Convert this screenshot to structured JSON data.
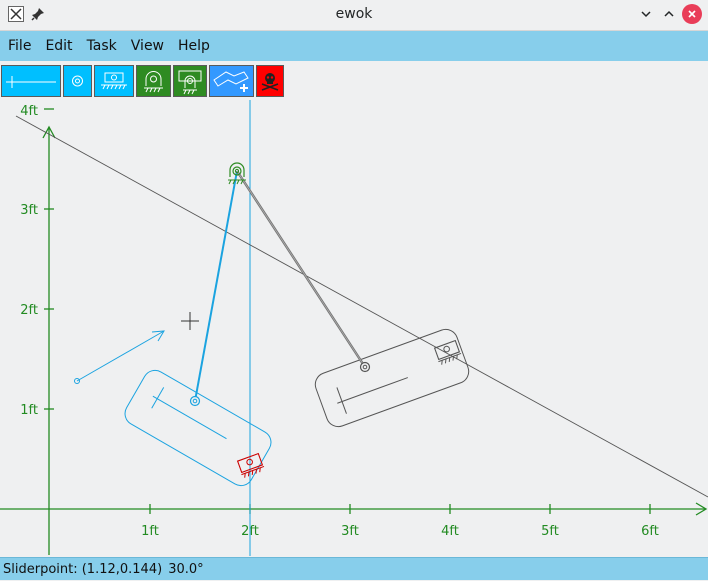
{
  "window": {
    "title": "ewok",
    "app_icon": "ewok-app-icon",
    "pin_icon": "pin-icon",
    "minimize_icon": "chevron-down-icon",
    "maximize_icon": "chevron-up-icon",
    "close_icon": "close-icon"
  },
  "menu": {
    "items": [
      {
        "label": "File"
      },
      {
        "label": "Edit"
      },
      {
        "label": "Task"
      },
      {
        "label": "View"
      },
      {
        "label": "Help"
      }
    ]
  },
  "toolbar": {
    "tools": [
      {
        "name": "line-tool",
        "icon": "line-icon",
        "color": "#00bfff"
      },
      {
        "name": "pivot-tool",
        "icon": "pivot-icon",
        "color": "#00bfff"
      },
      {
        "name": "slider-tool",
        "icon": "slider-icon",
        "color": "#00bfff"
      },
      {
        "name": "fixed-pivot-tool",
        "icon": "fixed-pivot-icon",
        "color": "#2e8b22"
      },
      {
        "name": "fixed-slider-tool",
        "icon": "fixed-slider-icon",
        "color": "#2e8b22"
      },
      {
        "name": "add-link-tool",
        "icon": "add-link-icon",
        "color": "#3399ff"
      },
      {
        "name": "delete-tool",
        "icon": "skull-icon",
        "color": "#ff0000"
      }
    ]
  },
  "canvas": {
    "x_ticks": [
      "1ft",
      "2ft",
      "3ft",
      "4ft",
      "5ft",
      "6ft"
    ],
    "y_ticks": [
      "1ft",
      "2ft",
      "3ft",
      "4ft"
    ],
    "axis_color": "#228b22",
    "link_color": "#00a8e0",
    "ghost_color": "#555555",
    "grounded_color": "#2e8b22",
    "constraint_color": "#cc0000"
  },
  "status": {
    "point": "Sliderpoint: (1.12,0.144)",
    "angle": "30.0°"
  }
}
